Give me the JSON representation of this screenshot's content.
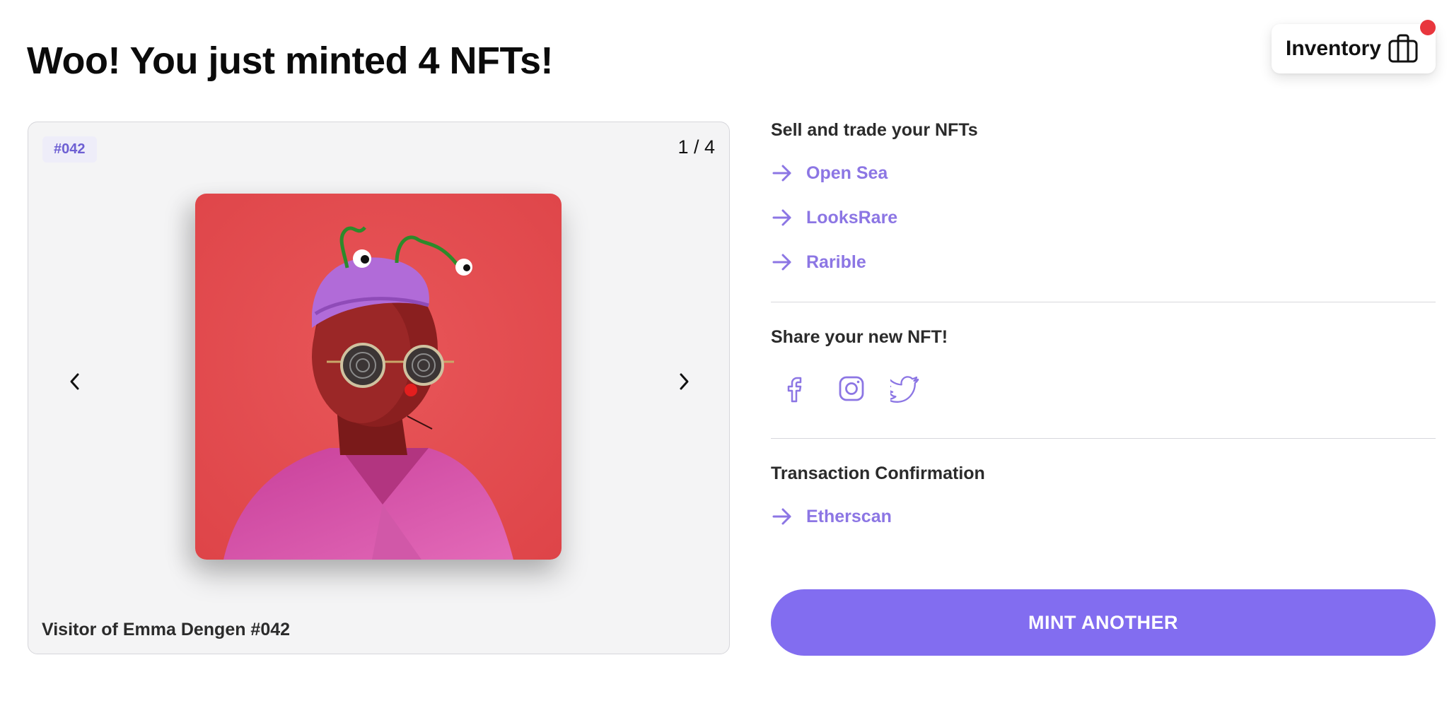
{
  "page": {
    "title": "Woo! You just minted 4 NFTs!"
  },
  "inventory": {
    "label": "Inventory",
    "icon": "bag-icon",
    "badge_color": "#e8363d"
  },
  "carousel": {
    "token_id": "#042",
    "counter": "1 / 4",
    "current_index": 1,
    "total": 4,
    "nft_name": "Visitor of Emma Dengen #042",
    "prev_icon": "chevron-left-icon",
    "next_icon": "chevron-right-icon"
  },
  "trade": {
    "heading": "Sell and trade your NFTs",
    "links": [
      {
        "label": "Open Sea",
        "icon": "arrow-right-icon"
      },
      {
        "label": "LooksRare",
        "icon": "arrow-right-icon"
      },
      {
        "label": "Rarible",
        "icon": "arrow-right-icon"
      }
    ]
  },
  "share": {
    "heading": "Share your new NFT!",
    "icons": [
      "facebook-icon",
      "instagram-icon",
      "twitter-icon"
    ]
  },
  "transaction": {
    "heading": "Transaction Confirmation",
    "link": {
      "label": "Etherscan",
      "icon": "arrow-right-icon"
    }
  },
  "actions": {
    "mint_label": "MINT ANOTHER"
  },
  "colors": {
    "accent": "#826df0",
    "link": "#8c76e4",
    "card_background": "#f4f4f5",
    "image_background": "#e34c50"
  }
}
